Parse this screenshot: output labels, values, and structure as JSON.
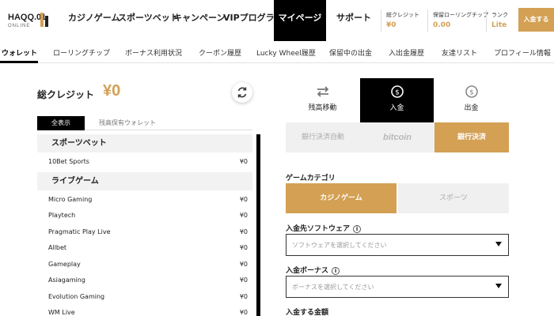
{
  "logo": {
    "line1": "HAQQ.01",
    "line2": "ONLINE"
  },
  "nav": {
    "items": [
      "カジノゲーム",
      "スポーツベット",
      "キャンペーン",
      "VIPプログラム",
      "マイページ",
      "サポート"
    ],
    "active": "マイページ"
  },
  "stats": [
    {
      "label": "総クレジット",
      "value": "¥0"
    },
    {
      "label": "保留ローリングチップ",
      "value": "0.00"
    },
    {
      "label": "ランク",
      "value": "Lite"
    }
  ],
  "deposit_button": "入金する",
  "subnav": {
    "items": [
      "ウォレット",
      "ローリングチップ",
      "ボーナス利用状況",
      "クーポン履歴",
      "Lucky Wheel履歴",
      "保留中の出金",
      "入出金履歴",
      "友達リスト",
      "プロフィール情報"
    ],
    "active": "ウォレット"
  },
  "wallet": {
    "credit_label": "総クレジット",
    "credit_value": "¥0",
    "tabs": [
      "全表示",
      "残高保有ウォレット"
    ],
    "categories": [
      {
        "name": "スポーツベット",
        "items": [
          {
            "name": "10Bet Sports",
            "amount": "¥0"
          }
        ]
      },
      {
        "name": "ライブゲーム",
        "items": [
          {
            "name": "Micro Gaming",
            "amount": "¥0"
          },
          {
            "name": "Playtech",
            "amount": "¥0"
          },
          {
            "name": "Pragmatic Play Live",
            "amount": "¥0"
          },
          {
            "name": "Allbet",
            "amount": "¥0"
          },
          {
            "name": "Gameplay",
            "amount": "¥0"
          },
          {
            "name": "Asiagaming",
            "amount": "¥0"
          },
          {
            "name": "Evolution Gaming",
            "amount": "¥0"
          },
          {
            "name": "WM Live",
            "amount": "¥0"
          }
        ]
      }
    ]
  },
  "transfer": {
    "tabs": [
      {
        "label": "残高移動",
        "icon": "transfer-arrows-icon"
      },
      {
        "label": "入金",
        "icon": "deposit-coin-icon"
      },
      {
        "label": "出金",
        "icon": "withdraw-coin-icon"
      }
    ],
    "active_tab": "入金",
    "methods": [
      "銀行決済自動",
      "bitcoin",
      "銀行決済"
    ],
    "active_method": "銀行決済",
    "game_category_label": "ゲームカテゴリ",
    "game_categories": [
      "カジノゲーム",
      "スポーツ"
    ],
    "active_game_category": "カジノゲーム",
    "software_label": "入金先ソフトウェア",
    "software_placeholder": "ソフトウェアを選択してください",
    "bonus_label": "入金ボーナス",
    "bonus_placeholder": "ボーナスを選択してください",
    "amount_label": "入金する金額"
  },
  "colors": {
    "accent": "#d3a054",
    "active_bg": "#000000",
    "inactive_bg": "#f0f0f0"
  }
}
